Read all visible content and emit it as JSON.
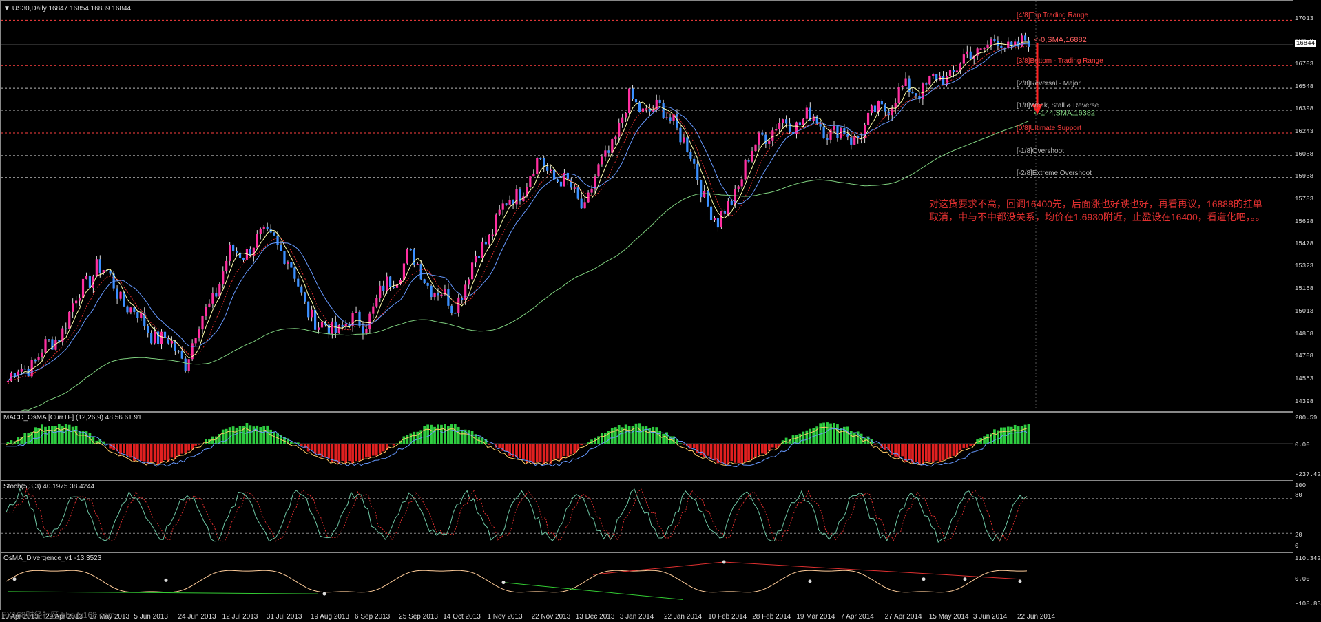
{
  "header": {
    "title": "US30,Daily",
    "ohlc": "16847 16854 16839 16844"
  },
  "price_axis": [
    "17013",
    "16858",
    "16703",
    "16548",
    "16398",
    "16243",
    "16088",
    "15938",
    "15783",
    "15628",
    "15478",
    "15323",
    "15168",
    "15013",
    "14858",
    "14708",
    "14553",
    "14398"
  ],
  "current_price_tag": "16844",
  "murrey_lines": [
    {
      "label": "[4/8]Top Trading Range",
      "price": 17013,
      "color": "#ff4040"
    },
    {
      "label": "[3/8]Bottom - Trading Range",
      "price": 16703,
      "color": "#ff4040"
    },
    {
      "label": "[2/8]Reversal - Major",
      "price": 16548,
      "color": "#bbbbbb"
    },
    {
      "label": "[1/8]Weak, Stall & Reverse",
      "price": 16398,
      "color": "#bbbbbb"
    },
    {
      "label": "[0/8]Ultimate Support",
      "price": 16243,
      "color": "#ff4040"
    },
    {
      "label": "[-1/8]Overshoot",
      "price": 16088,
      "color": "#bbbbbb"
    },
    {
      "label": "[-2/8]Extreme Overshoot",
      "price": 15938,
      "color": "#bbbbbb"
    }
  ],
  "sma_labels": [
    {
      "text": "<-0,SMA,16882",
      "color": "#ff6060"
    },
    {
      "text": "<-144,SMA,16382",
      "color": "#7fd17f"
    }
  ],
  "note": {
    "line1": "对这货要求不高，回调16400先，后面涨也好跌也好，再看再议，16888的挂单",
    "line2": "取消，中与不中都没关系，均价在1.6930附近，止盈设在16400，看造化吧，。。"
  },
  "macd": {
    "label": "MACD_OsMA [CurrTF] (12,26,9) 48.56 61.91",
    "axis": [
      "200.59",
      "0.00",
      "-237.42"
    ]
  },
  "stoch": {
    "label": "Stoch(5,3,3) 40.1975 38.4244",
    "axis": [
      "100",
      "80",
      "20",
      "0"
    ]
  },
  "osma_div": {
    "label": "OsMA_Divergence_v1 -13.3523",
    "axis": [
      "110.3422",
      "0.00",
      "-108.833"
    ]
  },
  "date_axis": [
    "10 Apr 2013",
    "29 Apr 2013",
    "17 May 2013",
    "5 Jun 2013",
    "24 Jun 2013",
    "12 Jul 2013",
    "31 Jul 2013",
    "19 Aug 2013",
    "6 Sep 2013",
    "25 Sep 2013",
    "14 Oct 2013",
    "1 Nov 2013",
    "22 Nov 2013",
    "13 Dec 2013",
    "3 Jan 2014",
    "22 Jan 2014",
    "10 Feb 2014",
    "28 Feb 2014",
    "19 Mar 2014",
    "7 Apr 2014",
    "27 Apr 2014",
    "15 May 2014",
    "3 Jun 2014",
    "22 Jun 2014"
  ],
  "watermark": "FX168财经社区 bbs.fx168.com",
  "colors": {
    "bull": "#ff2fa0",
    "bear": "#3a8fff",
    "macd_pos": "#2ecc40",
    "macd_neg": "#e02020",
    "sma_slow": "#7fd17f",
    "arrow": "#ff2020"
  },
  "chart_data": {
    "type": "candlestick",
    "title": "US30,Daily",
    "ylim": [
      14398,
      17090
    ],
    "close_path": [
      [
        "10 Apr 2013",
        14550
      ],
      [
        "29 Apr 2013",
        14800
      ],
      [
        "17 May 2013",
        15350
      ],
      [
        "5 Jun 2013",
        14950
      ],
      [
        "24 Jun 2013",
        14700
      ],
      [
        "12 Jul 2013",
        15400
      ],
      [
        "31 Jul 2013",
        15550
      ],
      [
        "19 Aug 2013",
        14900
      ],
      [
        "6 Sep 2013",
        14950
      ],
      [
        "25 Sep 2013",
        15400
      ],
      [
        "14 Oct 2013",
        15050
      ],
      [
        "1 Nov 2013",
        15650
      ],
      [
        "22 Nov 2013",
        16050
      ],
      [
        "13 Dec 2013",
        15750
      ],
      [
        "3 Jan 2014",
        16450
      ],
      [
        "22 Jan 2014",
        16350
      ],
      [
        "10 Feb 2014",
        15600
      ],
      [
        "28 Feb 2014",
        16250
      ],
      [
        "19 Mar 2014",
        16350
      ],
      [
        "7 Apr 2014",
        16200
      ],
      [
        "27 Apr 2014",
        16500
      ],
      [
        "15 May 2014",
        16600
      ],
      [
        "3 Jun 2014",
        16850
      ],
      [
        "22 Jun 2014",
        16844
      ]
    ]
  }
}
